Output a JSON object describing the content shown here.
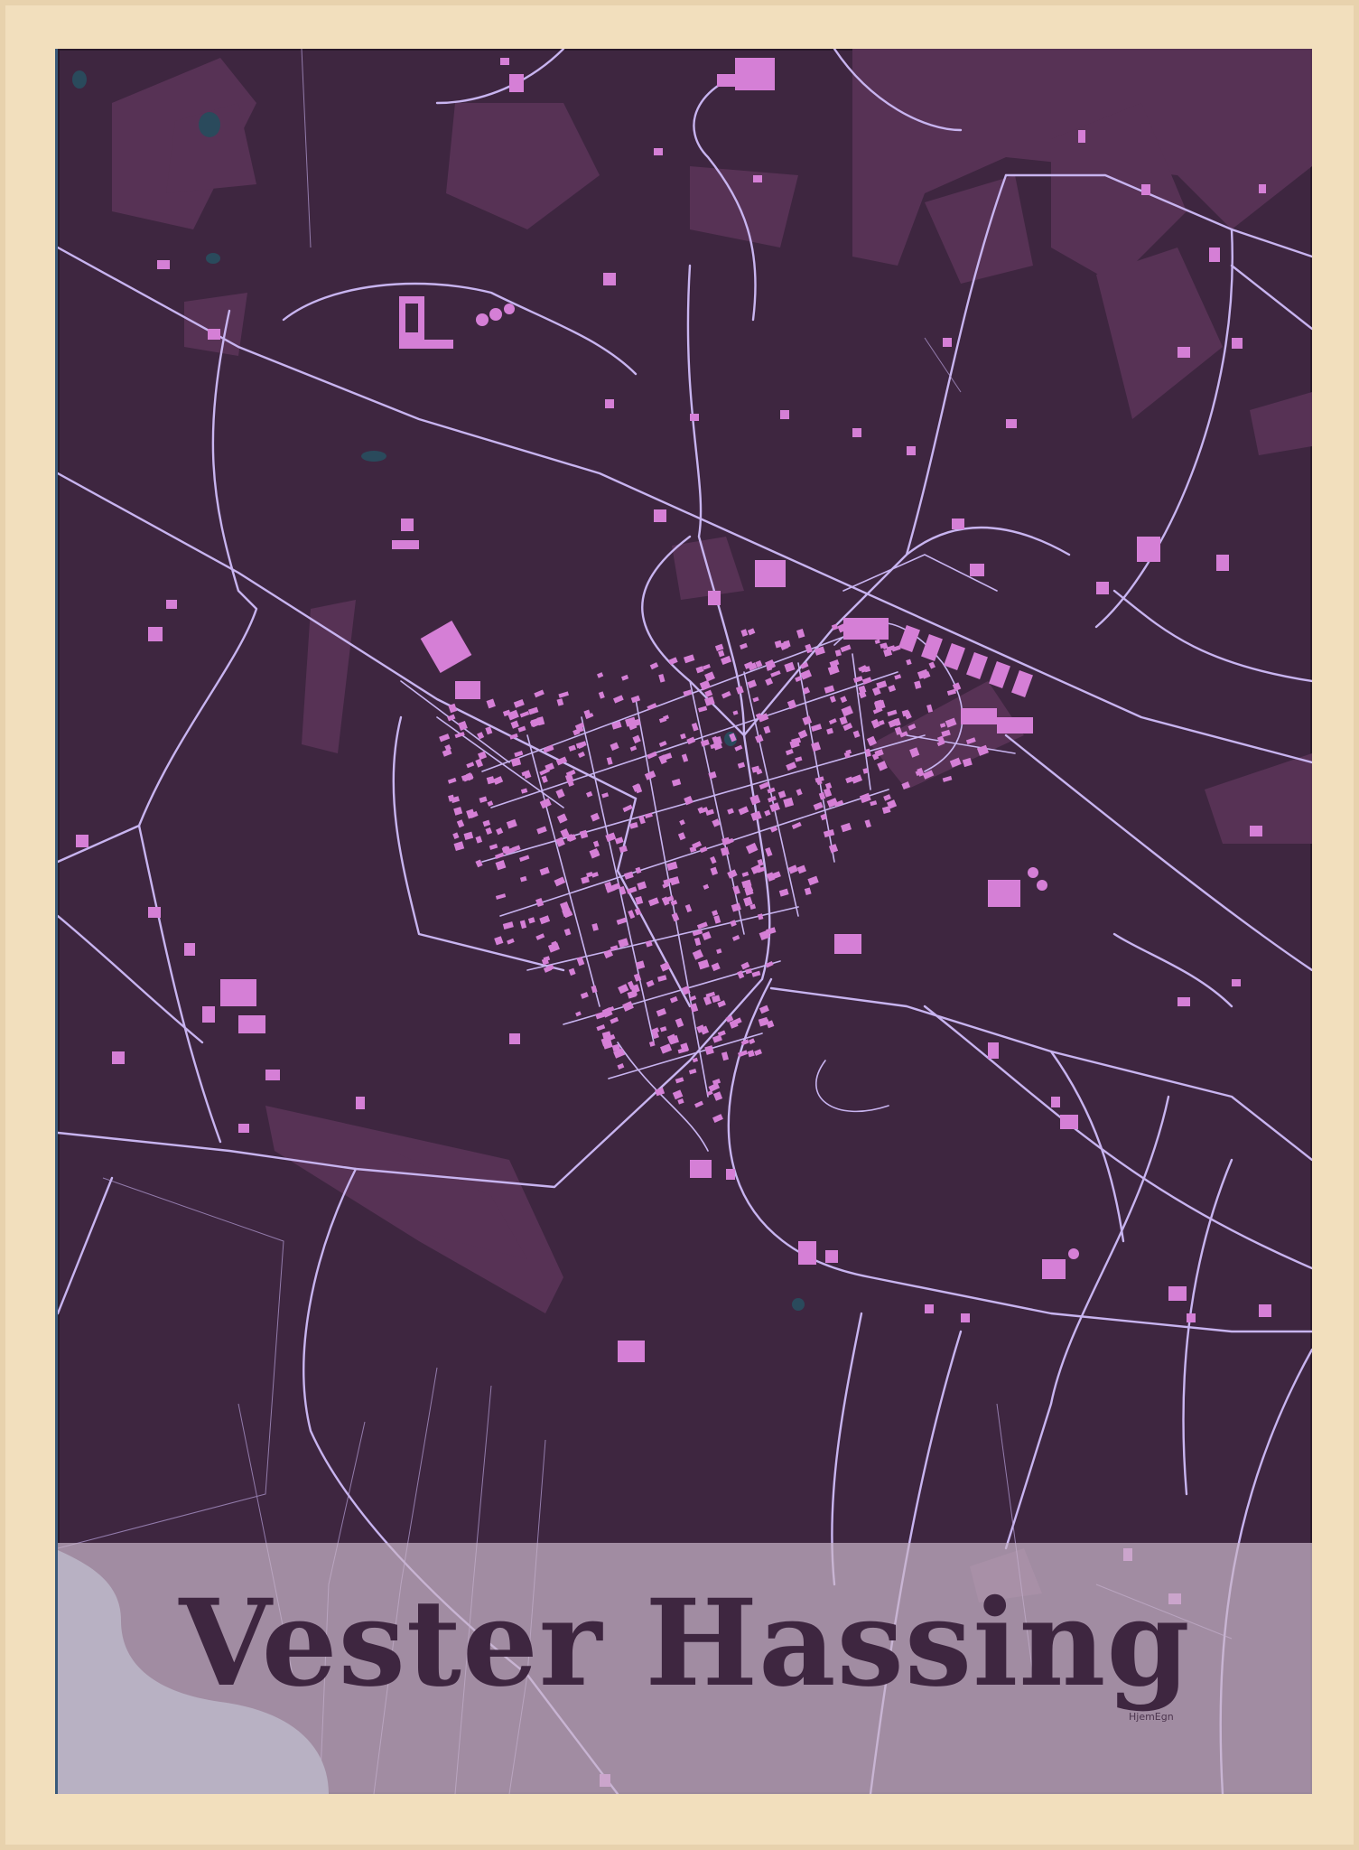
{
  "poster": {
    "title": "Vester Hassing",
    "credit": "HjemEgn"
  },
  "colors": {
    "frame": "#f2dfbd",
    "land": "#3e2640",
    "fields": "#5a3458",
    "roads": "#c8b4f0",
    "buildings": "#d57fd6",
    "water": "#8fa8b8",
    "band": "#c8b4c8"
  },
  "icons": {
    "water": "sea-area",
    "buildings": "building-footprints"
  }
}
